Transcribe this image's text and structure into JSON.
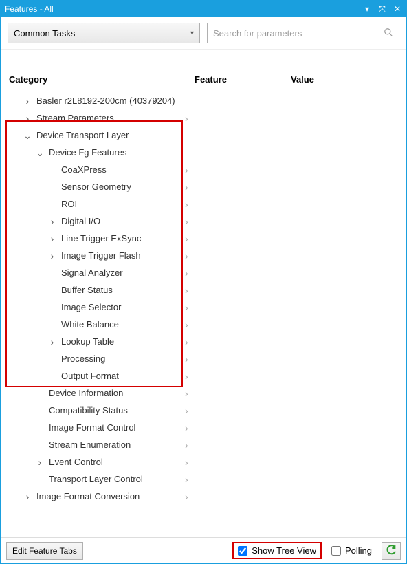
{
  "window": {
    "title": "Features - All"
  },
  "toolbar": {
    "dropdown_value": "Common Tasks",
    "search_placeholder": "Search for parameters"
  },
  "columns": {
    "category": "Category",
    "feature": "Feature",
    "value": "Value"
  },
  "tree": [
    {
      "label": "Basler r2L8192-200cm (40379204)",
      "indent": 1,
      "expand": "›",
      "more": false
    },
    {
      "label": "Stream Parameters",
      "indent": 1,
      "expand": "›",
      "more": true
    },
    {
      "label": "Device Transport Layer",
      "indent": 1,
      "expand": "⌄",
      "more": false
    },
    {
      "label": "Device Fg Features",
      "indent": 2,
      "expand": "⌄",
      "more": false
    },
    {
      "label": "CoaXPress",
      "indent": 3,
      "expand": "",
      "more": true
    },
    {
      "label": "Sensor Geometry",
      "indent": 3,
      "expand": "",
      "more": true
    },
    {
      "label": "ROI",
      "indent": 3,
      "expand": "",
      "more": true
    },
    {
      "label": "Digital I/O",
      "indent": 3,
      "expand": "›",
      "more": true
    },
    {
      "label": "Line Trigger ExSync",
      "indent": 3,
      "expand": "›",
      "more": true
    },
    {
      "label": "Image Trigger Flash",
      "indent": 3,
      "expand": "›",
      "more": true
    },
    {
      "label": "Signal Analyzer",
      "indent": 3,
      "expand": "",
      "more": true
    },
    {
      "label": "Buffer Status",
      "indent": 3,
      "expand": "",
      "more": true
    },
    {
      "label": "Image Selector",
      "indent": 3,
      "expand": "",
      "more": true
    },
    {
      "label": "White Balance",
      "indent": 3,
      "expand": "",
      "more": true
    },
    {
      "label": "Lookup Table",
      "indent": 3,
      "expand": "›",
      "more": true
    },
    {
      "label": "Processing",
      "indent": 3,
      "expand": "",
      "more": true
    },
    {
      "label": "Output Format",
      "indent": 3,
      "expand": "",
      "more": true
    },
    {
      "label": "Device Information",
      "indent": 2,
      "expand": "",
      "more": true
    },
    {
      "label": "Compatibility Status",
      "indent": 2,
      "expand": "",
      "more": true
    },
    {
      "label": "Image Format Control",
      "indent": 2,
      "expand": "",
      "more": true
    },
    {
      "label": "Stream Enumeration",
      "indent": 2,
      "expand": "",
      "more": true
    },
    {
      "label": "Event Control",
      "indent": 2,
      "expand": "›",
      "more": true
    },
    {
      "label": "Transport Layer Control",
      "indent": 2,
      "expand": "",
      "more": true
    },
    {
      "label": "Image Format Conversion",
      "indent": 1,
      "expand": "›",
      "more": true
    }
  ],
  "footer": {
    "edit_tabs": "Edit Feature Tabs",
    "show_tree": "Show Tree View",
    "show_tree_checked": true,
    "polling": "Polling",
    "polling_checked": false
  }
}
